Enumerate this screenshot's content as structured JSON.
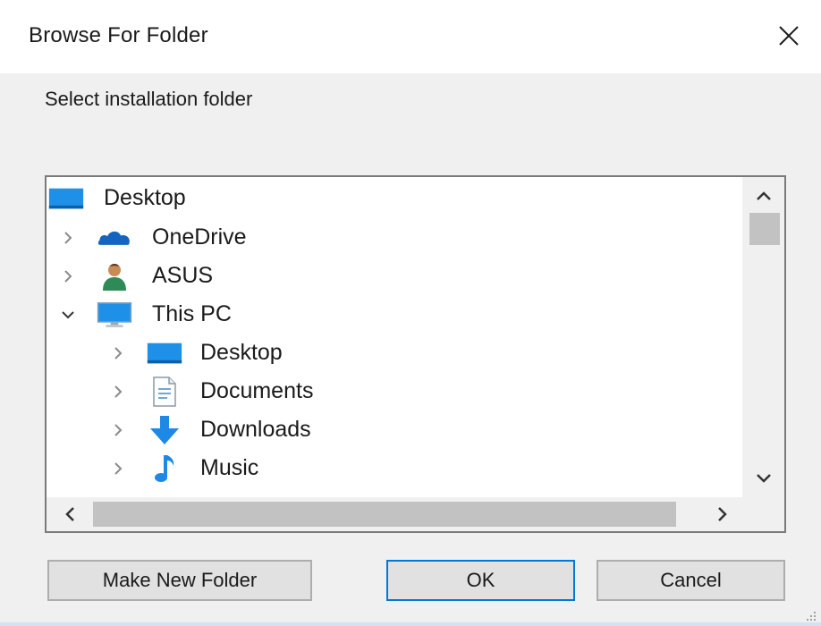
{
  "window": {
    "title": "Browse For Folder",
    "close_icon": "close-icon"
  },
  "prompt": "Select installation folder",
  "tree": {
    "items": [
      {
        "label": "Desktop",
        "icon": "desktop-icon",
        "expander": "none"
      },
      {
        "label": "OneDrive",
        "icon": "onedrive-cloud-icon",
        "expander": "collapsed"
      },
      {
        "label": "ASUS",
        "icon": "user-icon",
        "expander": "collapsed"
      },
      {
        "label": "This PC",
        "icon": "computer-icon",
        "expander": "expanded"
      },
      {
        "label": "Desktop",
        "icon": "desktop-icon",
        "expander": "collapsed"
      },
      {
        "label": "Documents",
        "icon": "documents-icon",
        "expander": "collapsed"
      },
      {
        "label": "Downloads",
        "icon": "downloads-arrow-icon",
        "expander": "collapsed"
      },
      {
        "label": "Music",
        "icon": "music-note-icon",
        "expander": "collapsed"
      }
    ]
  },
  "buttons": {
    "make_new_folder": "Make New Folder",
    "ok": "OK",
    "cancel": "Cancel"
  },
  "colors": {
    "accent": "#0078d7",
    "folder_blue": "#1e90e8",
    "dialog_bg": "#f0f0f0"
  }
}
